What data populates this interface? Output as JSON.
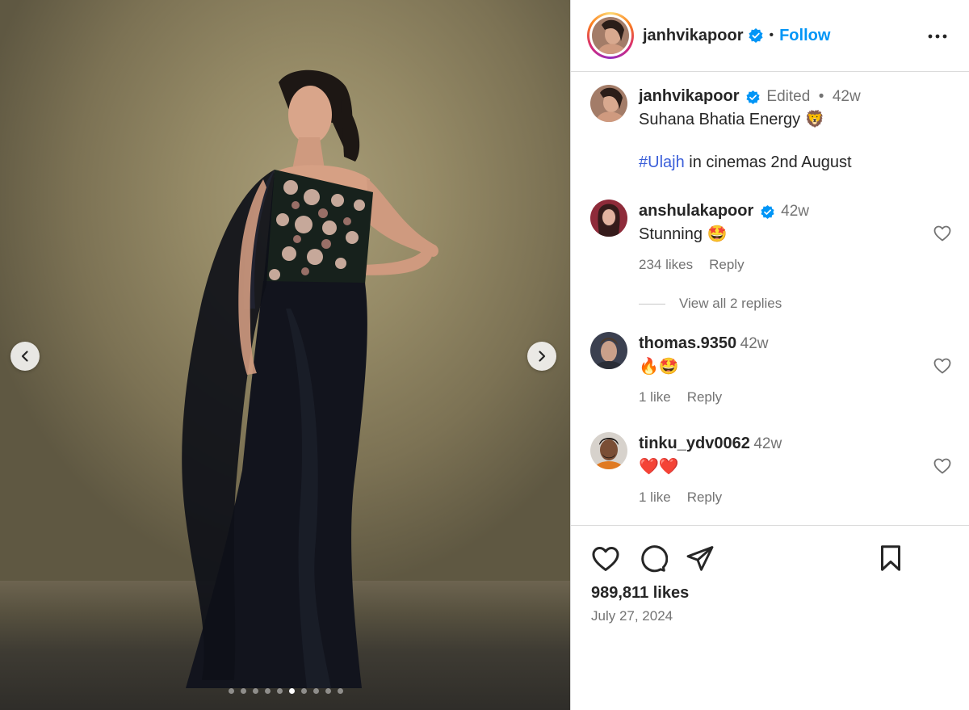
{
  "post": {
    "author": "janhvikapoor",
    "follow_label": "Follow",
    "separator": "•",
    "caption": {
      "edited_label": "Edited",
      "dot": "•",
      "age": "42w",
      "line1": "Suhana Bhatia Energy 🦁",
      "hashtag": "#Ulajh",
      "line2_rest": " in cinemas 2nd August"
    },
    "likes_label": "989,811 likes",
    "date": "July 27, 2024",
    "carousel": {
      "total": 10,
      "active_index": 5
    }
  },
  "comments": [
    {
      "username": "anshulakapoor",
      "verified": true,
      "age": "42w",
      "text": "Stunning 🤩",
      "likes": "234 likes",
      "reply_label": "Reply",
      "view_replies": "View all 2 replies"
    },
    {
      "username": "thomas.9350",
      "verified": false,
      "age": "42w",
      "text": "🔥🤩",
      "likes": "1 like",
      "reply_label": "Reply"
    },
    {
      "username": "tinku_ydv0062",
      "verified": false,
      "age": "42w",
      "text": "❤️❤️",
      "likes": "1 like",
      "reply_label": "Reply"
    }
  ],
  "colors": {
    "accent": "#0095f6",
    "verified": "#0095f6",
    "text": "#262626",
    "muted": "#737373"
  },
  "icons": [
    "chevron-left-icon",
    "chevron-right-icon",
    "more-icon",
    "heart-icon",
    "comment-icon",
    "share-icon",
    "bookmark-icon",
    "verified-icon"
  ]
}
